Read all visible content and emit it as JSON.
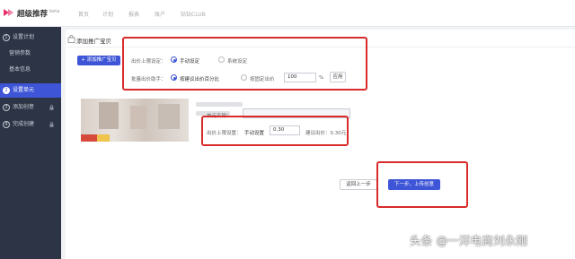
{
  "topbar": {
    "logo_text": "超级推荐",
    "logo_beta": "beta",
    "nav": [
      "首页",
      "计划",
      "报表",
      "账户",
      "钻钻CLUB"
    ]
  },
  "sidebar": {
    "items": [
      {
        "num": "1",
        "label": "设置计划"
      },
      {
        "num": "",
        "label": "营销参数"
      },
      {
        "num": "",
        "label": "基本信息"
      },
      {
        "num": "2",
        "label": "设置单元"
      },
      {
        "num": "3",
        "label": "添加创意"
      },
      {
        "num": "4",
        "label": "完成创建"
      }
    ]
  },
  "main": {
    "page_title": "添加推广宝贝",
    "add_button": "+ 添加推广宝贝",
    "bid_limit_label": "出价上限设定：",
    "bid_manual": "手动设定",
    "bid_system": "系统设定",
    "batch_label": "批量出价助手：",
    "batch_by_percent": "按建议出价百分比",
    "batch_by_fixed": "按固定出价",
    "batch_value": "100",
    "batch_unit": "%",
    "apply_button": "应用",
    "unit_name_label": "单元名称：",
    "item_bid_label": "出价上限设置：",
    "item_bid_mode": "手动设置",
    "item_bid_value": "0.30",
    "item_suggest": "建议出价：0.30元",
    "prev_button": "返回上一步",
    "next_button": "下一步，上传创意"
  },
  "watermark": "头条 @一洋电商刘永刚",
  "colors": {
    "accent": "#3d55d6",
    "sidebar_bg": "#2c3445",
    "annotation_red": "#d92b2b"
  }
}
